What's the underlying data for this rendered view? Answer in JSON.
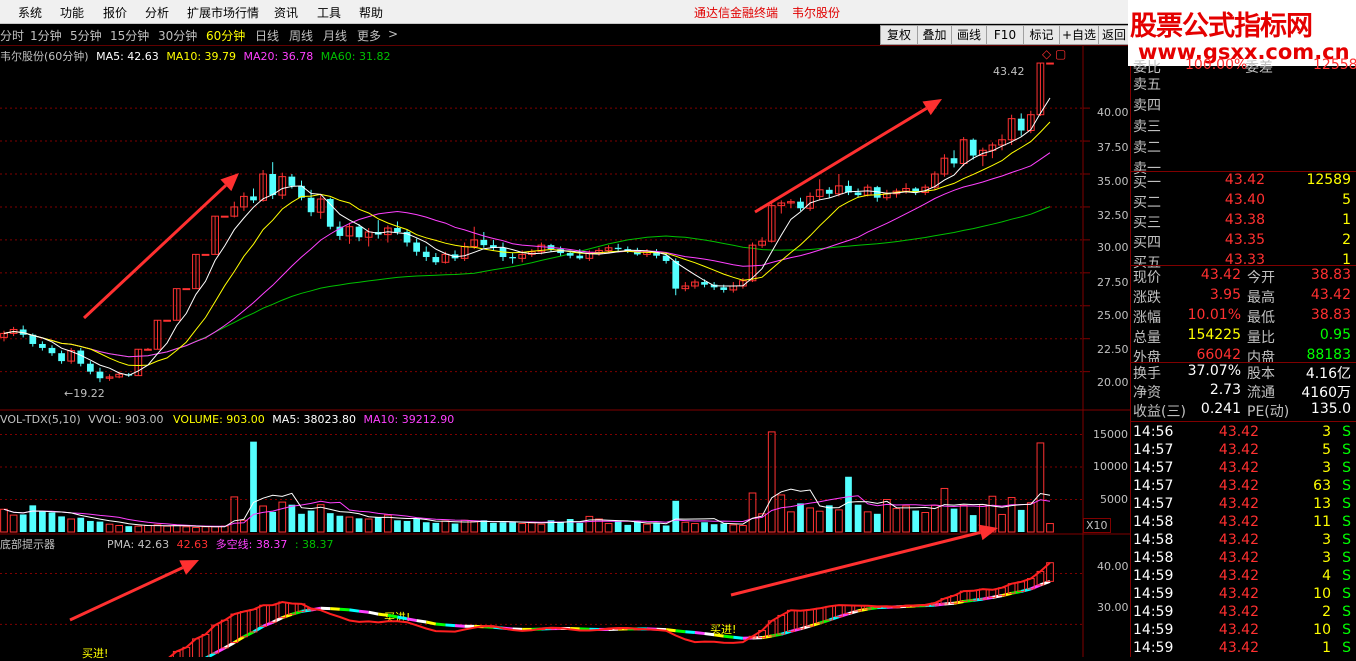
{
  "menu": {
    "items": [
      "系统",
      "功能",
      "报价",
      "分析",
      "扩展市场行情",
      "资讯",
      "工具",
      "帮助"
    ],
    "app_title": "通达信金融终端",
    "stock_title": "韦尔股份"
  },
  "toolbar": {
    "periods": [
      "分时",
      "1分钟",
      "5分钟",
      "15分钟",
      "30分钟",
      "60分钟",
      "日线",
      "周线",
      "月线",
      "更多"
    ],
    "active_period": "60分钟",
    "more_arrow": ">",
    "buttons": [
      "复权",
      "叠加",
      "画线",
      "F10",
      "标记",
      "+自选",
      "返回"
    ]
  },
  "brand": {
    "title": "股票公式指标网",
    "url": "www.gsxx.com.cn"
  },
  "main_chart": {
    "stock_label": "韦尔股份(60分钟)",
    "ma5": "MA5: 42.63",
    "ma10": "MA10: 39.79",
    "ma20": "MA20: 36.78",
    "ma60": "MA60: 31.82",
    "high_label": "43.42",
    "low_label": "19.22",
    "y_ticks": [
      "40.00",
      "37.50",
      "35.00",
      "32.50",
      "30.00",
      "27.50",
      "25.00",
      "22.50",
      "20.00"
    ],
    "y_tick_values": [
      40,
      37.5,
      35,
      32.5,
      30,
      27.5,
      25,
      22.5,
      20
    ],
    "price_range": [
      18,
      43.5
    ]
  },
  "volume_chart": {
    "title": "VOL-TDX(5,10)",
    "vvol": "VVOL: 903.00",
    "volume": "VOLUME: 903.00",
    "ma5": "MA5: 38023.80",
    "ma10": "MA10: 39212.90",
    "y_ticks": [
      "15000",
      "10000",
      "5000"
    ],
    "y_tick_values": [
      15000,
      10000,
      5000
    ],
    "unit": "X10",
    "range": [
      0,
      16000
    ]
  },
  "indicator_chart": {
    "title": "底部提示器",
    "pma": "PMA: 42.63",
    "pma_value": "42.63",
    "duokong": "多空线: 38.37",
    "extra": ": 38.37",
    "buy_label": "买进!",
    "y_ticks": [
      "40.00",
      "30.00"
    ],
    "y_tick_values": [
      40,
      30
    ],
    "range": [
      24,
      45
    ]
  },
  "chart_data": {
    "type": "candlestick",
    "ylim": [
      18,
      43.5
    ],
    "candles": [
      [
        22.6,
        23.1,
        22.3,
        22.9
      ],
      [
        22.9,
        23.4,
        22.7,
        23.2
      ],
      [
        23.2,
        23.5,
        22.6,
        22.8
      ],
      [
        22.8,
        22.9,
        21.9,
        22.1
      ],
      [
        22.1,
        22.3,
        21.6,
        21.8
      ],
      [
        21.8,
        22.0,
        21.2,
        21.4
      ],
      [
        21.4,
        21.6,
        20.6,
        20.8
      ],
      [
        20.8,
        21.8,
        20.6,
        21.6
      ],
      [
        21.6,
        21.8,
        20.4,
        20.6
      ],
      [
        20.6,
        20.8,
        19.8,
        20.0
      ],
      [
        20.0,
        20.3,
        19.2,
        19.5
      ],
      [
        19.5,
        19.8,
        19.3,
        19.6
      ],
      [
        19.6,
        20.0,
        19.5,
        19.8
      ],
      [
        19.8,
        19.9,
        19.6,
        19.7
      ],
      [
        19.7,
        21.7,
        19.7,
        21.7
      ],
      [
        21.7,
        21.8,
        21.7,
        21.7
      ],
      [
        21.7,
        23.9,
        21.7,
        23.9
      ],
      [
        23.9,
        23.9,
        23.9,
        23.9
      ],
      [
        23.9,
        26.3,
        23.9,
        26.3
      ],
      [
        26.3,
        26.3,
        26.3,
        26.3
      ],
      [
        26.3,
        28.9,
        26.3,
        28.9
      ],
      [
        28.9,
        28.9,
        28.9,
        28.9
      ],
      [
        28.9,
        31.8,
        28.9,
        31.8
      ],
      [
        31.8,
        31.8,
        31.8,
        31.8
      ],
      [
        31.8,
        32.9,
        31.7,
        32.5
      ],
      [
        32.5,
        33.6,
        32.2,
        33.3
      ],
      [
        33.3,
        33.9,
        32.8,
        33.0
      ],
      [
        33.0,
        35.3,
        32.9,
        35.0
      ],
      [
        35.0,
        35.9,
        33.1,
        33.4
      ],
      [
        33.4,
        35.1,
        33.1,
        34.8
      ],
      [
        34.8,
        35.0,
        33.9,
        34.1
      ],
      [
        34.1,
        34.5,
        33.0,
        33.2
      ],
      [
        33.2,
        33.8,
        31.8,
        32.1
      ],
      [
        32.1,
        33.4,
        31.6,
        33.1
      ],
      [
        33.1,
        33.2,
        30.8,
        31.0
      ],
      [
        31.0,
        31.4,
        30.0,
        30.3
      ],
      [
        30.3,
        31.3,
        29.7,
        31.0
      ],
      [
        31.0,
        31.2,
        29.9,
        30.2
      ],
      [
        30.2,
        30.9,
        29.5,
        30.6
      ],
      [
        30.6,
        31.5,
        30.1,
        30.4
      ],
      [
        30.4,
        31.1,
        29.8,
        30.9
      ],
      [
        30.9,
        31.4,
        30.4,
        30.6
      ],
      [
        30.6,
        30.8,
        29.5,
        29.8
      ],
      [
        29.8,
        30.1,
        28.8,
        29.1
      ],
      [
        29.1,
        29.5,
        28.4,
        28.7
      ],
      [
        28.7,
        29.0,
        28.1,
        28.3
      ],
      [
        28.3,
        29.1,
        28.2,
        28.9
      ],
      [
        28.9,
        29.2,
        28.4,
        28.6
      ],
      [
        28.6,
        29.8,
        28.4,
        29.5
      ],
      [
        29.5,
        31.0,
        29.3,
        30.0
      ],
      [
        30.0,
        30.6,
        29.4,
        29.6
      ],
      [
        29.6,
        30.0,
        29.2,
        29.4
      ],
      [
        29.4,
        29.8,
        28.4,
        28.7
      ],
      [
        28.7,
        29.0,
        28.2,
        28.6
      ],
      [
        28.6,
        29.2,
        28.3,
        28.9
      ],
      [
        28.9,
        29.3,
        28.7,
        29.1
      ],
      [
        29.1,
        29.8,
        28.9,
        29.6
      ],
      [
        29.6,
        29.7,
        29.1,
        29.3
      ],
      [
        29.3,
        29.5,
        28.8,
        29.0
      ],
      [
        29.0,
        29.2,
        28.6,
        28.8
      ],
      [
        28.8,
        29.3,
        28.5,
        28.6
      ],
      [
        28.6,
        29.2,
        28.4,
        29.0
      ],
      [
        29.0,
        29.4,
        28.8,
        29.2
      ],
      [
        29.2,
        29.6,
        29.0,
        29.4
      ],
      [
        29.4,
        29.7,
        29.1,
        29.3
      ],
      [
        29.3,
        29.5,
        29.0,
        29.2
      ],
      [
        29.2,
        29.4,
        28.8,
        28.9
      ],
      [
        28.9,
        29.3,
        28.7,
        29.1
      ],
      [
        29.1,
        29.3,
        28.6,
        28.8
      ],
      [
        28.8,
        29.0,
        28.2,
        28.4
      ],
      [
        28.4,
        28.6,
        25.8,
        26.3
      ],
      [
        26.3,
        26.8,
        26.1,
        26.5
      ],
      [
        26.5,
        27.0,
        26.3,
        26.8
      ],
      [
        26.8,
        27.0,
        26.4,
        26.6
      ],
      [
        26.6,
        26.8,
        26.2,
        26.4
      ],
      [
        26.4,
        26.6,
        26.0,
        26.2
      ],
      [
        26.2,
        26.8,
        26.0,
        26.5
      ],
      [
        26.5,
        27.1,
        26.3,
        26.9
      ],
      [
        26.9,
        29.8,
        26.8,
        29.6
      ],
      [
        29.6,
        30.2,
        29.4,
        29.9
      ],
      [
        29.9,
        32.8,
        29.8,
        32.6
      ],
      [
        32.6,
        33.0,
        32.0,
        32.8
      ],
      [
        32.8,
        33.1,
        32.4,
        32.9
      ],
      [
        32.9,
        33.2,
        32.2,
        32.4
      ],
      [
        32.4,
        33.6,
        32.2,
        33.3
      ],
      [
        33.3,
        34.6,
        33.0,
        33.8
      ],
      [
        33.8,
        34.0,
        33.2,
        33.5
      ],
      [
        33.5,
        35.0,
        33.3,
        34.1
      ],
      [
        34.1,
        34.5,
        33.4,
        33.6
      ],
      [
        33.6,
        33.9,
        33.2,
        33.4
      ],
      [
        33.4,
        34.2,
        33.3,
        34.0
      ],
      [
        34.0,
        34.1,
        32.9,
        33.2
      ],
      [
        33.2,
        33.8,
        33.0,
        33.5
      ],
      [
        33.5,
        33.9,
        33.2,
        33.7
      ],
      [
        33.7,
        34.3,
        33.5,
        33.9
      ],
      [
        33.9,
        34.0,
        33.4,
        33.6
      ],
      [
        33.6,
        34.2,
        33.4,
        34.0
      ],
      [
        34.0,
        35.2,
        33.8,
        35.0
      ],
      [
        35.0,
        36.5,
        34.8,
        36.2
      ],
      [
        36.2,
        36.8,
        35.5,
        35.8
      ],
      [
        35.8,
        37.8,
        35.6,
        37.6
      ],
      [
        37.6,
        37.7,
        36.1,
        36.4
      ],
      [
        36.4,
        37.0,
        35.6,
        36.8
      ],
      [
        36.8,
        37.4,
        36.2,
        37.2
      ],
      [
        37.2,
        38.0,
        36.8,
        37.6
      ],
      [
        37.6,
        39.5,
        37.2,
        39.2
      ],
      [
        39.2,
        39.6,
        37.9,
        38.3
      ],
      [
        38.3,
        39.8,
        38.1,
        39.5
      ],
      [
        39.5,
        43.42,
        39.4,
        43.42
      ],
      [
        43.42,
        43.42,
        43.42,
        43.42
      ]
    ],
    "volume": [
      3500,
      2600,
      2700,
      4100,
      3200,
      3000,
      2400,
      2000,
      2200,
      1700,
      1600,
      1200,
      1000,
      900,
      900,
      1000,
      1100,
      900,
      1000,
      800,
      700,
      800,
      800,
      900,
      5400,
      1800,
      13900,
      4000,
      3100,
      4600,
      4200,
      2800,
      3300,
      4200,
      2900,
      2500,
      2300,
      2100,
      2000,
      2300,
      2600,
      1800,
      1700,
      2000,
      1500,
      1400,
      1700,
      1300,
      1800,
      1600,
      1800,
      1400,
      1500,
      1600,
      1300,
      1400,
      1200,
      1800,
      1600,
      2000,
      1400,
      2400,
      2000,
      1300,
      1700,
      1100,
      1600,
      1200,
      1400,
      1000,
      4800,
      1500,
      1300,
      1500,
      1200,
      1300,
      1100,
      1000,
      6000,
      2800,
      15400,
      5700,
      3100,
      4400,
      3700,
      3200,
      4100,
      3400,
      8500,
      4200,
      3100,
      2800,
      5000,
      3600,
      4000,
      3300,
      3000,
      4100,
      6700,
      3600,
      4100,
      2600,
      4200,
      5500,
      2700,
      5300,
      3400,
      4500,
      13700,
      1300
    ]
  },
  "order_book": {
    "top_label": "委比",
    "top_value": "100.00%",
    "top_label2": "委差",
    "top_value2": "12558",
    "sell": [
      [
        "卖五",
        "",
        ""
      ],
      [
        "卖四",
        "",
        ""
      ],
      [
        "卖三",
        "",
        ""
      ],
      [
        "卖二",
        "",
        ""
      ],
      [
        "卖一",
        "",
        ""
      ]
    ],
    "buy": [
      [
        "买一",
        "43.42",
        "12589"
      ],
      [
        "买二",
        "43.40",
        "5"
      ],
      [
        "买三",
        "43.38",
        "1"
      ],
      [
        "买四",
        "43.35",
        "2"
      ],
      [
        "买五",
        "43.33",
        "1"
      ]
    ]
  },
  "quote": [
    {
      "l1": "现价",
      "v1": "43.42",
      "c1": "#ff3030",
      "l2": "今开",
      "v2": "38.83",
      "c2": "#ff3030"
    },
    {
      "l1": "涨跌",
      "v1": "3.95",
      "c1": "#ff3030",
      "l2": "最高",
      "v2": "43.42",
      "c2": "#ff3030"
    },
    {
      "l1": "涨幅",
      "v1": "10.01%",
      "c1": "#ff3030",
      "l2": "最低",
      "v2": "38.83",
      "c2": "#ff3030"
    },
    {
      "l1": "总量",
      "v1": "154225",
      "c1": "#ffff00",
      "l2": "量比",
      "v2": "0.95",
      "c2": "#00ff00"
    },
    {
      "l1": "外盘",
      "v1": "66042",
      "c1": "#ff3030",
      "l2": "内盘",
      "v2": "88183",
      "c2": "#00ff00"
    }
  ],
  "fundamentals": [
    {
      "l1": "换手",
      "v1": "37.07%",
      "l2": "股本",
      "v2": "4.16亿"
    },
    {
      "l1": "净资",
      "v1": "2.73",
      "l2": "流通",
      "v2": "4160万"
    },
    {
      "l1": "收益(三)",
      "v1": "0.241",
      "l2": "PE(动)",
      "v2": "135.0"
    }
  ],
  "ticks": [
    [
      "14:56",
      "43.42",
      "3",
      "S"
    ],
    [
      "14:57",
      "43.42",
      "5",
      "S"
    ],
    [
      "14:57",
      "43.42",
      "3",
      "S"
    ],
    [
      "14:57",
      "43.42",
      "63",
      "S"
    ],
    [
      "14:57",
      "43.42",
      "13",
      "S"
    ],
    [
      "14:58",
      "43.42",
      "11",
      "S"
    ],
    [
      "14:58",
      "43.42",
      "3",
      "S"
    ],
    [
      "14:58",
      "43.42",
      "3",
      "S"
    ],
    [
      "14:59",
      "43.42",
      "4",
      "S"
    ],
    [
      "14:59",
      "43.42",
      "10",
      "S"
    ],
    [
      "14:59",
      "43.42",
      "2",
      "S"
    ],
    [
      "14:59",
      "43.42",
      "10",
      "S"
    ],
    [
      "14:59",
      "43.42",
      "1",
      "S"
    ]
  ],
  "colors": {
    "up": "#ff3232",
    "down": "#54ffff",
    "ma5": "#ffffff",
    "ma10": "#ffff00",
    "ma20": "#ff40ff",
    "ma60": "#00c000",
    "grid": "#800000",
    "arrow": "#ff3030"
  }
}
